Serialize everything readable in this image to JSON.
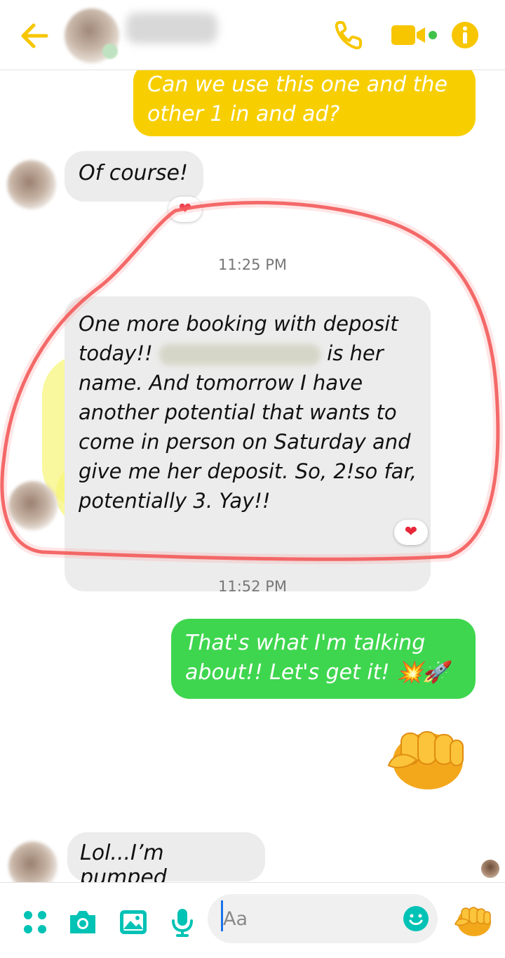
{
  "header": {
    "back_icon": "arrow-left-icon",
    "call_icon": "phone-icon",
    "video_icon": "video-camera-icon",
    "info_icon": "info-icon",
    "accent_color": "#f7c600"
  },
  "messages": {
    "outgoing_1": "Can we use this one and the other 1 in and ad?",
    "incoming_1": "Of course!",
    "timestamp_1": "11:25 PM",
    "incoming_2_part1": "One more booking with deposit today!!",
    "incoming_2_part2": " is her name. And tomorrow I have another potential that wants to come in person on Saturday and give me her deposit. So, 2!so far, potentially 3. Yay!!",
    "timestamp_2": "11:52 PM",
    "outgoing_2": "That's what I'm talking about!! Let's get it! 💥🚀",
    "outgoing_3": "fist-bump-emoji",
    "incoming_3": "Lol...I’m pumped"
  },
  "reactions": {
    "heart": "❤"
  },
  "composer": {
    "placeholder": "Aa",
    "menu_icon": "four-dots-icon",
    "camera_icon": "camera-icon",
    "gallery_icon": "image-icon",
    "mic_icon": "microphone-icon",
    "emoji_icon": "smiley-icon",
    "send_icon": "fist-bump-icon",
    "accent_color": "#00c2b5"
  },
  "colors": {
    "outgoing_yellow": "#f7cf00",
    "outgoing_green": "#3fd64f",
    "incoming_gray": "#ececec",
    "annotation_red": "#ef4646",
    "highlight_yellow": "#f7f578"
  }
}
